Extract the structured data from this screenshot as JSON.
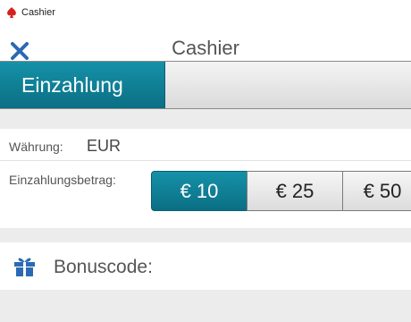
{
  "window": {
    "title": "Cashier",
    "icon": "spade-app-icon"
  },
  "header": {
    "title": "Cashier",
    "close_icon": "close-icon"
  },
  "tabs": [
    {
      "label": "Einzahlung",
      "active": true
    },
    {
      "label": "",
      "active": false
    }
  ],
  "currency": {
    "label": "Währung:",
    "value": "EUR"
  },
  "deposit": {
    "label": "Einzahlungsbetrag:",
    "amounts": [
      {
        "label": "€ 10",
        "selected": true
      },
      {
        "label": "€ 25",
        "selected": false
      },
      {
        "label": "€ 50",
        "selected": false
      }
    ]
  },
  "bonus": {
    "label": "Bonuscode:",
    "icon": "gift-icon"
  },
  "colors": {
    "accent": "#0e7f95",
    "close": "#2a6ab4",
    "gift": "#2a6ab4",
    "app_icon": "#d62020"
  }
}
